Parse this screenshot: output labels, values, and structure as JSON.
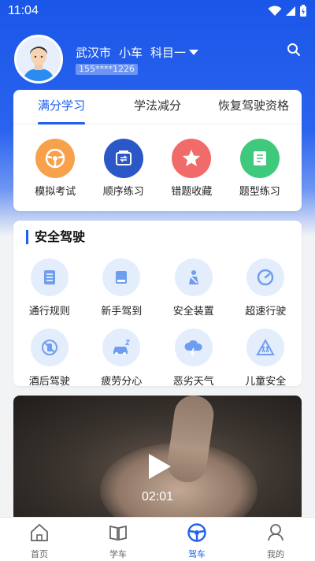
{
  "status_bar": {
    "time": "11:04"
  },
  "profile": {
    "city": "武汉市",
    "vehicle": "小车",
    "subject": "科目一",
    "phone": "155****1226"
  },
  "study": {
    "tabs": [
      {
        "label": "满分学习",
        "active": true
      },
      {
        "label": "学法减分",
        "active": false
      },
      {
        "label": "恢复驾驶资格",
        "active": false
      }
    ],
    "items": [
      {
        "label": "模拟考试",
        "icon": "steering-wheel-icon",
        "color": "#f7a24a"
      },
      {
        "label": "顺序练习",
        "icon": "sequence-icon",
        "color": "#2b57c7"
      },
      {
        "label": "错题收藏",
        "icon": "star-icon",
        "color": "#f26b6b"
      },
      {
        "label": "题型练习",
        "icon": "book-icon",
        "color": "#3ec97c"
      }
    ]
  },
  "safety": {
    "title": "安全驾驶",
    "items": [
      {
        "label": "通行规则",
        "icon": "rules-list-icon"
      },
      {
        "label": "新手驾到",
        "icon": "novice-book-icon"
      },
      {
        "label": "安全装置",
        "icon": "seatbelt-icon"
      },
      {
        "label": "超速行驶",
        "icon": "speedometer-icon"
      },
      {
        "label": "酒后驾驶",
        "icon": "no-drink-icon"
      },
      {
        "label": "疲劳分心",
        "icon": "tired-car-icon"
      },
      {
        "label": "恶劣天气",
        "icon": "storm-cloud-icon"
      },
      {
        "label": "儿童安全",
        "icon": "child-safety-icon"
      }
    ]
  },
  "video": {
    "duration": "02:01"
  },
  "bottom_nav": [
    {
      "label": "首页",
      "icon": "home-icon",
      "active": false
    },
    {
      "label": "学车",
      "icon": "open-book-icon",
      "active": false
    },
    {
      "label": "驾车",
      "icon": "steering-wheel-icon",
      "active": true
    },
    {
      "label": "我的",
      "icon": "profile-icon",
      "active": false
    }
  ],
  "colors": {
    "accent": "#1e5ef0",
    "icon_bg": "#e3edfc",
    "icon_fg": "#6f9ef0"
  }
}
